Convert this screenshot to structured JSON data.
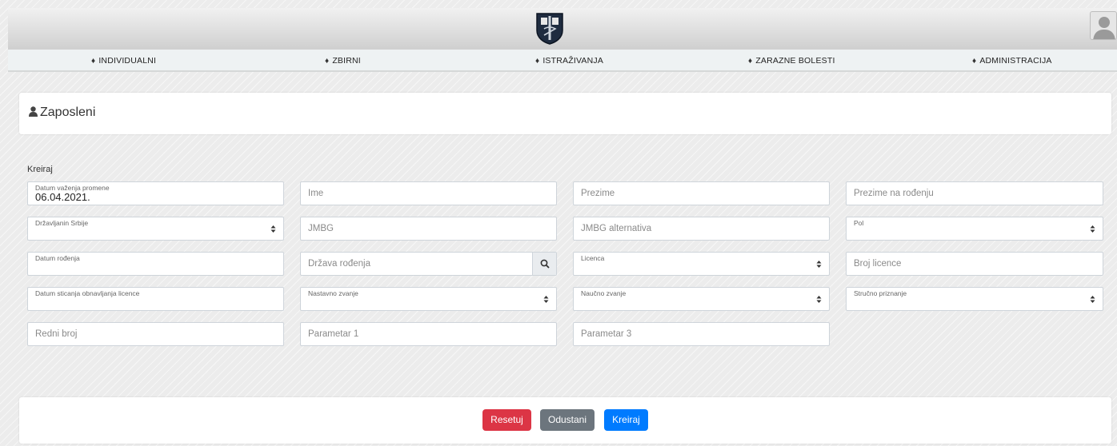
{
  "nav": [
    {
      "label": "INDIVIDUALNI",
      "icon": "flask-icon"
    },
    {
      "label": "ZBIRNI",
      "icon": "flask-icon"
    },
    {
      "label": "ISTRAŽIVANJA",
      "icon": "flask-icon"
    },
    {
      "label": "ZARAZNE BOLESTI",
      "icon": "flask-icon"
    },
    {
      "label": "ADMINISTRACIJA",
      "icon": "flask-icon"
    }
  ],
  "page": {
    "title": "Zaposleni",
    "section": "Kreiraj"
  },
  "form": {
    "datum_vazenja": {
      "label": "Datum važenja promene",
      "value": "06.04.2021."
    },
    "ime": {
      "placeholder": "Ime"
    },
    "prezime": {
      "placeholder": "Prezime"
    },
    "prezime_rodjenje": {
      "placeholder": "Prezime na rođenju"
    },
    "drzavljanin": {
      "label": "Državljanin Srbije"
    },
    "jmbg": {
      "placeholder": "JMBG"
    },
    "jmbg_alt": {
      "placeholder": "JMBG alternativa"
    },
    "pol": {
      "label": "Pol"
    },
    "datum_rodjenja": {
      "label": "Datum rođenja"
    },
    "drzava_rodjenja": {
      "placeholder": "Država rođenja"
    },
    "licenca": {
      "label": "Licenca"
    },
    "broj_licence": {
      "placeholder": "Broj licence"
    },
    "datum_licence": {
      "label": "Datum sticanja obnavljanja licence"
    },
    "nastavno_zvanje": {
      "label": "Nastavno zvanje"
    },
    "naucno_zvanje": {
      "label": "Naučno zvanje"
    },
    "strucno_priznanje": {
      "label": "Stručno priznanje"
    },
    "redni_broj": {
      "placeholder": "Redni broj"
    },
    "parametar1": {
      "placeholder": "Parametar 1"
    },
    "parametar3": {
      "placeholder": "Parametar 3"
    }
  },
  "buttons": {
    "reset": "Resetuj",
    "cancel": "Odustani",
    "create": "Kreiraj"
  },
  "colors": {
    "danger": "#dc3545",
    "secondary": "#6c757d",
    "primary": "#007bff"
  }
}
